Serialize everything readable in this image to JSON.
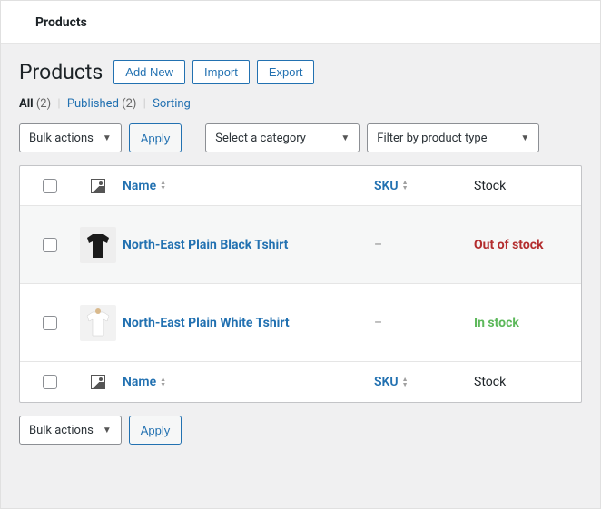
{
  "topbar": {
    "title": "Products"
  },
  "heading": {
    "title": "Products",
    "addNew": "Add New",
    "import": "Import",
    "export": "Export"
  },
  "filters": {
    "all_label": "All",
    "all_count": "(2)",
    "published_label": "Published",
    "published_count": "(2)",
    "sorting_label": "Sorting"
  },
  "controls": {
    "bulkActions": "Bulk actions",
    "apply": "Apply",
    "selectCategory": "Select a category",
    "filterType": "Filter by product type"
  },
  "columns": {
    "name": "Name",
    "sku": "SKU",
    "stock": "Stock"
  },
  "rows": [
    {
      "name": "North-East Plain Black Tshirt",
      "sku": "–",
      "stock": "Out of stock",
      "stockClass": "stock-out",
      "thumb": "black"
    },
    {
      "name": "North-East Plain White Tshirt",
      "sku": "–",
      "stock": "In stock",
      "stockClass": "stock-in",
      "thumb": "white"
    }
  ]
}
